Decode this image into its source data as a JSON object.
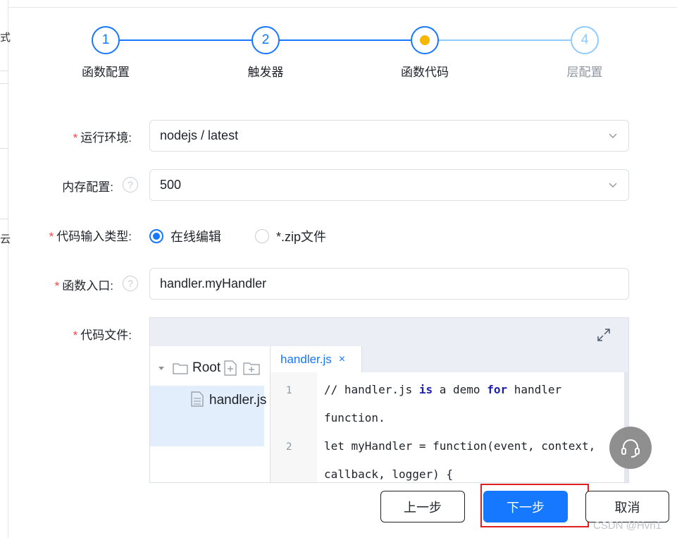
{
  "steps": [
    {
      "number": "1",
      "label": "函数配置",
      "state": "done"
    },
    {
      "number": "2",
      "label": "触发器",
      "state": "done"
    },
    {
      "number": "",
      "label": "函数代码",
      "state": "active"
    },
    {
      "number": "4",
      "label": "层配置",
      "state": "pending"
    }
  ],
  "form": {
    "runtime": {
      "label": "运行环境:",
      "required": true,
      "value": "nodejs / latest"
    },
    "memory": {
      "label": "内存配置:",
      "required": false,
      "value": "500"
    },
    "code_input_type": {
      "label": "代码输入类型:",
      "required": true,
      "options": [
        {
          "label": "在线编辑",
          "checked": true
        },
        {
          "label": "*.zip文件",
          "checked": false
        }
      ]
    },
    "entry": {
      "label": "函数入口:",
      "required": true,
      "value": "handler.myHandler"
    },
    "code_file": {
      "label": "代码文件:",
      "required": true
    }
  },
  "editor": {
    "tree_root": "Root",
    "tree_file": "handler.js",
    "tab_label": "handler.js",
    "tab_close": "×",
    "line_numbers": [
      "1",
      "2"
    ],
    "lines": [
      {
        "before": "// handler.js ",
        "kw1": "is",
        "mid": " a demo ",
        "kw2": "for",
        "after": " handler"
      },
      {
        "text": "function."
      },
      {
        "text": "let myHandler = function(event, context,"
      },
      {
        "text": "callback, logger) {"
      }
    ]
  },
  "buttons": {
    "prev": "上一步",
    "next": "下一步",
    "cancel": "取消"
  },
  "watermark": "CSDN @Hvri1",
  "colors": {
    "primary": "#1677ff",
    "active_dot": "#f5b800",
    "required": "#f53f3f",
    "highlight": "#e02020"
  }
}
